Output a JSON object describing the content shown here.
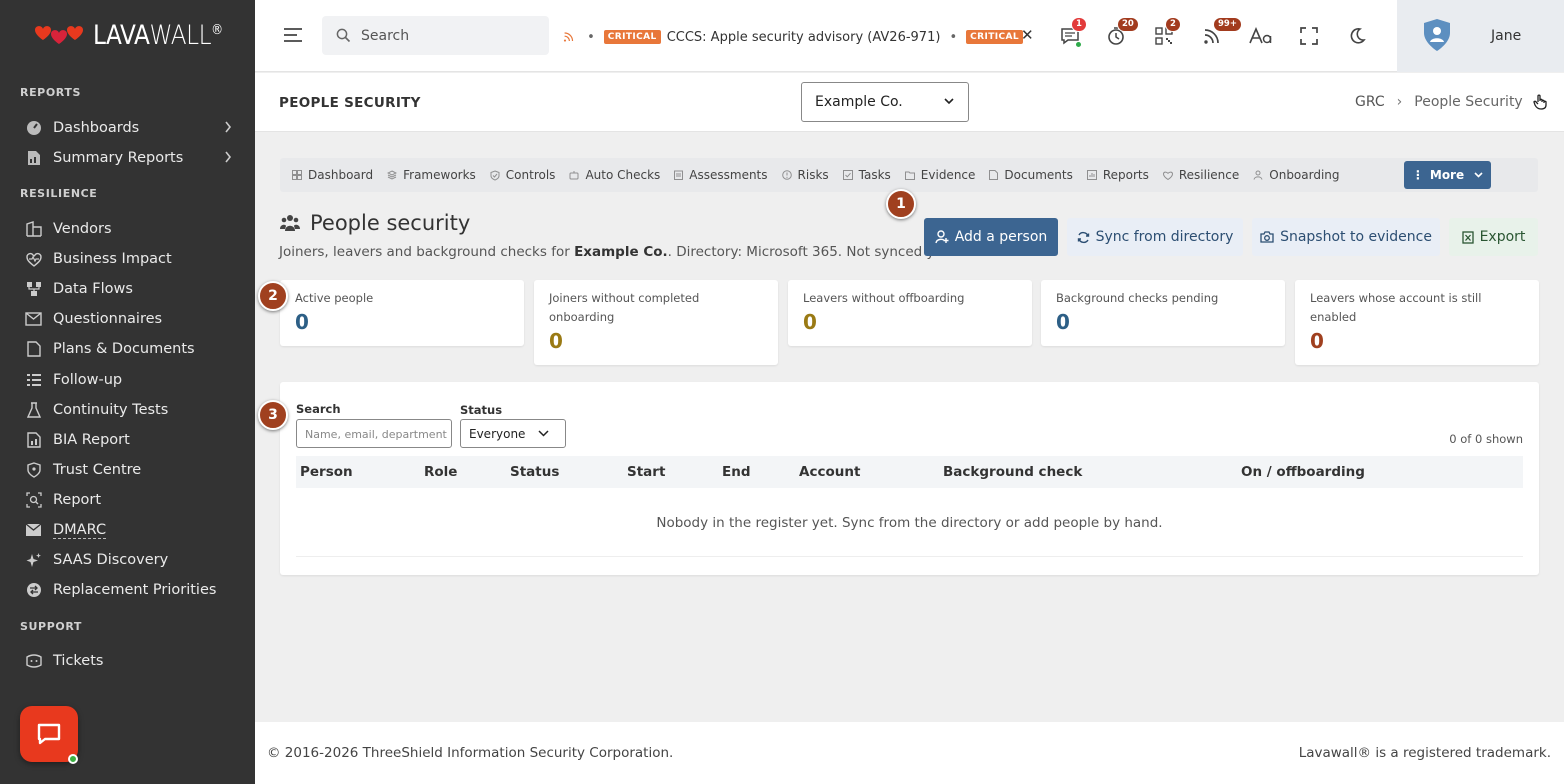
{
  "brand": {
    "name_part1": "LAVA",
    "name_part2": "WALL",
    "reg": "®"
  },
  "sidebar": {
    "sections": [
      {
        "title": "REPORTS"
      },
      {
        "title": "RESILIENCE"
      },
      {
        "title": "SUPPORT"
      }
    ],
    "items": [
      {
        "label": "Dashboards",
        "icon": "gauge-icon"
      },
      {
        "label": "Summary Reports",
        "icon": "report-icon"
      },
      {
        "label": "Vendors",
        "icon": "building-icon"
      },
      {
        "label": "Business Impact",
        "icon": "heart-icon"
      },
      {
        "label": "Data Flows",
        "icon": "flow-icon"
      },
      {
        "label": "Questionnaires",
        "icon": "envelope-icon"
      },
      {
        "label": "Plans & Documents",
        "icon": "document-icon"
      },
      {
        "label": "Follow-up",
        "icon": "list-icon"
      },
      {
        "label": "Continuity Tests",
        "icon": "flask-icon"
      },
      {
        "label": "BIA Report",
        "icon": "chart-icon"
      },
      {
        "label": "Trust Centre",
        "icon": "shield-icon"
      },
      {
        "label": "Report",
        "icon": "search-report-icon"
      },
      {
        "label": "DMARC",
        "icon": "mail-check-icon"
      },
      {
        "label": "SAAS Discovery",
        "icon": "sparkle-icon"
      },
      {
        "label": "Replacement Priorities",
        "icon": "swap-icon"
      },
      {
        "label": "Tickets",
        "icon": "ticket-icon"
      }
    ]
  },
  "topbar": {
    "search_placeholder": "Search",
    "ticker": [
      {
        "badge": "CRITICAL",
        "text": "CCCS: Apple security advisory (AV26-971)"
      },
      {
        "badge": "CRITICAL",
        "text": ""
      }
    ],
    "counts": {
      "messages": "1",
      "timer": "20",
      "qr": "2",
      "feeds": "99+"
    },
    "user_name": "Jane"
  },
  "page": {
    "title": "PEOPLE SECURITY",
    "org_selected": "Example Co.",
    "breadcrumb": [
      "GRC",
      "People Security"
    ]
  },
  "tabs": [
    "Dashboard",
    "Frameworks",
    "Controls",
    "Auto Checks",
    "Assessments",
    "Risks",
    "Tasks",
    "Evidence",
    "Documents",
    "Reports",
    "Resilience",
    "Onboarding"
  ],
  "more_label": "More",
  "section": {
    "title": "People security",
    "desc_prefix": "Joiners, leavers and background checks for ",
    "desc_org": "Example Co.",
    "desc_suffix": ". Directory: Microsoft 365. Not synced yet."
  },
  "actions": {
    "add": "Add a person",
    "sync": "Sync from directory",
    "snapshot": "Snapshot to evidence",
    "export": "Export"
  },
  "markers": [
    "1",
    "2",
    "3"
  ],
  "stats": [
    {
      "label": "Active people",
      "value": "0",
      "color": "#2d5f86"
    },
    {
      "label": "Joiners without completed onboarding",
      "value": "0",
      "color": "#9a7a14"
    },
    {
      "label": "Leavers without offboarding",
      "value": "0",
      "color": "#9a7a14"
    },
    {
      "label": "Background checks pending",
      "value": "0",
      "color": "#2d5f86"
    },
    {
      "label": "Leavers whose account is still enabled",
      "value": "0",
      "color": "#a0401f"
    }
  ],
  "filters": {
    "search_label": "Search",
    "search_placeholder": "Name, email, department",
    "status_label": "Status",
    "status_value": "Everyone",
    "shown": "0 of 0 shown"
  },
  "table": {
    "columns": [
      "Person",
      "Role",
      "Status",
      "Start",
      "End",
      "Account",
      "Background check",
      "On / offboarding"
    ],
    "empty": "Nobody in the register yet. Sync from the directory or add people by hand."
  },
  "footer": {
    "copyright": "© 2016-2026 ThreeShield Information Security Corporation.",
    "trademark": "Lavawall® is a registered trademark."
  },
  "colors": {
    "sidebar": "#333333",
    "primary": "#3c6591",
    "accent": "#e8391e",
    "marker": "#a0401f"
  }
}
